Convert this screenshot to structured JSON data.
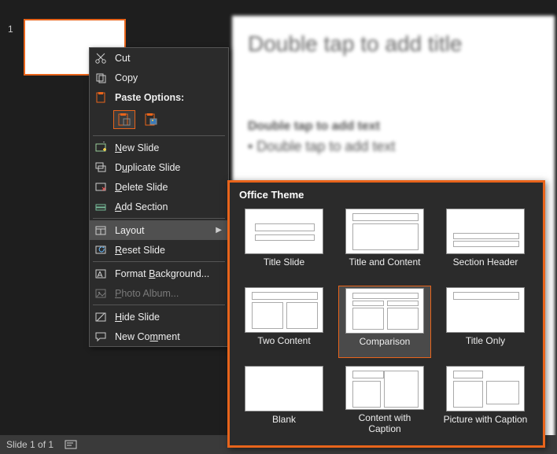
{
  "slide_panel": {
    "number": "1"
  },
  "editor": {
    "title_placeholder": "Double tap to add title",
    "subtitle_placeholder": "Double tap to add text",
    "bullet_placeholder": "• Double tap to add text"
  },
  "status": {
    "slide_count": "Slide 1 of 1"
  },
  "ctx": {
    "cut": "Cut",
    "copy": "Copy",
    "paste_options": "Paste Options:",
    "new_slide": "New Slide",
    "duplicate_slide": "Duplicate Slide",
    "delete_slide": "Delete Slide",
    "add_section": "Add Section",
    "layout": "Layout",
    "reset_slide": "Reset Slide",
    "format_background": "Format Background...",
    "photo_album": "Photo Album...",
    "hide_slide": "Hide Slide",
    "new_comment": "New Comment"
  },
  "flyout": {
    "heading": "Office Theme",
    "layouts": {
      "title_slide": "Title Slide",
      "title_and_content": "Title and Content",
      "section_header": "Section Header",
      "two_content": "Two Content",
      "comparison": "Comparison",
      "title_only": "Title Only",
      "blank": "Blank",
      "content_with_caption": "Content with Caption",
      "picture_with_caption": "Picture with Caption"
    },
    "selected": "Comparison"
  }
}
